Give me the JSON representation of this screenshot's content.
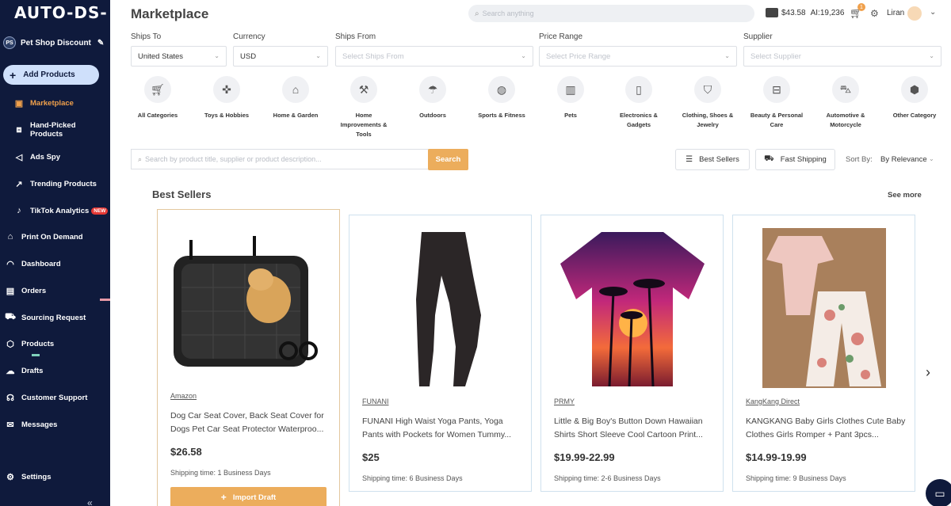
{
  "app": {
    "logo": "AUTO-DS-"
  },
  "store": {
    "initials": "PS",
    "name": "Pet Shop Discount"
  },
  "sidebar": {
    "add_products": "Add Products",
    "items": [
      {
        "label": "Marketplace",
        "icon": "bag-icon"
      },
      {
        "label": "Hand-Picked Products",
        "icon": "box-star-icon"
      },
      {
        "label": "Ads Spy",
        "icon": "megaphone-icon"
      },
      {
        "label": "Trending Products",
        "icon": "trend-icon"
      },
      {
        "label": "TikTok Analytics",
        "icon": "tiktok-icon",
        "badge": "NEW"
      },
      {
        "label": "Print On Demand",
        "icon": "print-icon"
      },
      {
        "label": "Dashboard",
        "icon": "gauge-icon"
      },
      {
        "label": "Orders",
        "icon": "orders-icon"
      },
      {
        "label": "Sourcing Request",
        "icon": "truck-icon"
      },
      {
        "label": "Products",
        "icon": "cube-icon"
      },
      {
        "label": "Drafts",
        "icon": "drafts-icon"
      },
      {
        "label": "Customer Support",
        "icon": "headset-icon"
      },
      {
        "label": "Messages",
        "icon": "mail-icon"
      },
      {
        "label": "Settings",
        "icon": "gear-icon"
      }
    ],
    "collapse": "«"
  },
  "header": {
    "title": "Marketplace",
    "search_placeholder": "Search anything",
    "balance": "$43.58",
    "ai_credits": "AI:19,236",
    "cart_count": "1",
    "user": "Liran"
  },
  "filters": [
    {
      "label": "Ships To",
      "value": "United States",
      "placeholder": false
    },
    {
      "label": "Currency",
      "value": "USD",
      "placeholder": false
    },
    {
      "label": "Ships From",
      "value": "Select Ships From",
      "placeholder": true
    },
    {
      "label": "Price Range",
      "value": "Select Price Range",
      "placeholder": true
    },
    {
      "label": "Supplier",
      "value": "Select Supplier",
      "placeholder": true
    }
  ],
  "categories": [
    {
      "label": "All Categories",
      "icon": "cart-icon"
    },
    {
      "label": "Toys & Hobbies",
      "icon": "gamepad-icon"
    },
    {
      "label": "Home & Garden",
      "icon": "house-icon"
    },
    {
      "label": "Home Improvements & Tools",
      "icon": "tools-icon"
    },
    {
      "label": "Outdoors",
      "icon": "umbrella-icon"
    },
    {
      "label": "Sports & Fitness",
      "icon": "ball-icon"
    },
    {
      "label": "Pets",
      "icon": "pet-icon"
    },
    {
      "label": "Electronics & Gadgets",
      "icon": "phone-icon"
    },
    {
      "label": "Clothing, Shoes & Jewelry",
      "icon": "shirt-icon"
    },
    {
      "label": "Beauty & Personal Care",
      "icon": "beauty-icon"
    },
    {
      "label": "Automotive & Motorcycle",
      "icon": "car-icon"
    },
    {
      "label": "Other Category",
      "icon": "package-icon"
    }
  ],
  "product_search": {
    "placeholder": "Search by product title, supplier or product description...",
    "button": "Search"
  },
  "toolbar": {
    "best_sellers": "Best Sellers",
    "fast_shipping": "Fast Shipping",
    "sort_label": "Sort By:",
    "sort_value": "By Relevance"
  },
  "section": {
    "title": "Best Sellers",
    "see_more": "See more"
  },
  "products": [
    {
      "supplier": "Amazon",
      "title": "Dog Car Seat Cover, Back Seat Cover for Dogs Pet Car Seat Protector Waterproo...",
      "price": "$26.58",
      "shipping": "Shipping time: 1 Business Days",
      "image": "black quilted pet seat cover with golden retriever"
    },
    {
      "supplier": "FUNANI",
      "title": "FUNANI High Waist Yoga Pants, Yoga Pants with Pockets for Women Tummy...",
      "price": "$25",
      "shipping": "Shipping time: 6 Business Days",
      "image": "black capri yoga leggings"
    },
    {
      "supplier": "PRMY",
      "title": "Little & Big Boy's Button Down Hawaiian Shirts Short Sleeve Cool Cartoon Print...",
      "price": "$19.99-22.99",
      "shipping": "Shipping time: 2-6 Business Days",
      "image": "sunset palm tree hawaiian shirt"
    },
    {
      "supplier": "KangKang Direct",
      "title": "KANGKANG Baby Girls Clothes Cute Baby Clothes Girls Romper + Pant 3pcs...",
      "price": "$14.99-19.99",
      "shipping": "Shipping time: 9 Business Days",
      "image": "pink baby romper with floral pants"
    }
  ],
  "import_button": "Import Draft",
  "colors": {
    "sidebar": "#0f1a3c",
    "accent": "#ecad5c",
    "active": "#f0a04b"
  }
}
